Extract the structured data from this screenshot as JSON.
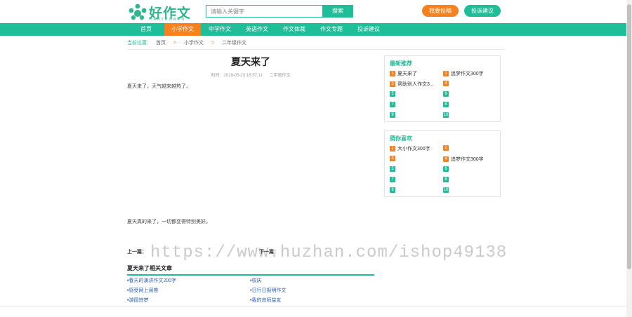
{
  "header": {
    "logo_text": "好作文",
    "logo_sub": "HAOZUOWEN",
    "search_placeholder": "请输入关键字",
    "search_button": "搜索",
    "btn_left": "我要投稿",
    "btn_right": "投诉建议"
  },
  "nav": {
    "items": [
      {
        "label": "首页"
      },
      {
        "label": "小学作文"
      },
      {
        "label": "中学作文"
      },
      {
        "label": "英语作文"
      },
      {
        "label": "作文体裁"
      },
      {
        "label": "作文专题"
      },
      {
        "label": "投诉建议"
      }
    ],
    "active_index": 1
  },
  "breadcrumb": {
    "label": "当前位置：",
    "sep": ">",
    "items": [
      "首页",
      "小学作文",
      "二年级作文"
    ]
  },
  "article": {
    "title": "夏天来了",
    "meta": {
      "time": "时间：2019-05-23 16:57:11",
      "category": "二年级作文"
    },
    "paragraphs": [
      "夏天来了，天气越来越热了。",
      "",
      "",
      "",
      "",
      "夏天真的来了，一切都变得特别美好。"
    ]
  },
  "prev_next": {
    "prev_label": "上一篇：",
    "next_label": "下一篇："
  },
  "related": {
    "title": "夏天来了相关文章",
    "items": [
      "春天的演讲作文200字",
      "校庆",
      "感受网上阅卷",
      "日行日报明作文",
      "游园惊梦",
      "我的良师益友"
    ]
  },
  "sidebar": {
    "latest": {
      "title": "最新推荐",
      "items": [
        {
          "num": "1",
          "title": "夏天来了",
          "accent": "orange"
        },
        {
          "num": "2",
          "title": "追梦作文300字",
          "accent": "orange"
        },
        {
          "num": "3",
          "title": "帮助别人作文3...",
          "accent": "orange"
        },
        {
          "num": "4",
          "title": "",
          "accent": "orange"
        },
        {
          "num": "5",
          "title": "",
          "accent": "green"
        },
        {
          "num": "6",
          "title": "",
          "accent": "green"
        },
        {
          "num": "7",
          "title": "",
          "accent": "green"
        },
        {
          "num": "8",
          "title": "",
          "accent": "green"
        },
        {
          "num": "9",
          "title": "",
          "accent": "green"
        },
        {
          "num": "10",
          "title": "",
          "accent": "green"
        }
      ]
    },
    "hot": {
      "title": "猜你喜欢",
      "items": [
        {
          "num": "1",
          "title": "大小作文300字",
          "accent": "orange"
        },
        {
          "num": "2",
          "title": "",
          "accent": "orange"
        },
        {
          "num": "3",
          "title": "",
          "accent": "orange"
        },
        {
          "num": "4",
          "title": "追梦作文300字",
          "accent": "orange"
        },
        {
          "num": "5",
          "title": "",
          "accent": "green"
        },
        {
          "num": "6",
          "title": "",
          "accent": "green"
        },
        {
          "num": "7",
          "title": "",
          "accent": "green"
        },
        {
          "num": "8",
          "title": "",
          "accent": "green"
        },
        {
          "num": "9",
          "title": "",
          "accent": "green"
        },
        {
          "num": "10",
          "title": "",
          "accent": "green"
        }
      ]
    }
  },
  "watermark": "https://www.huzhan.com/ishop49138",
  "colors": {
    "brand_green": "#1fbd98",
    "accent_orange": "#f5821f"
  }
}
